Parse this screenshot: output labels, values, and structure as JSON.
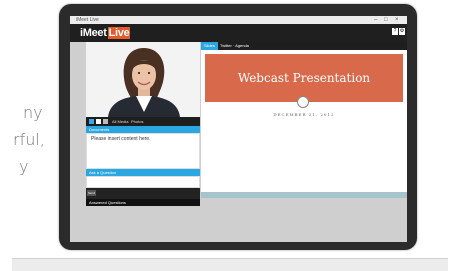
{
  "background_text": [
    "ny",
    "rful,",
    "y"
  ],
  "window": {
    "title": "iMeet Live",
    "controls": [
      "–",
      "□",
      "×"
    ]
  },
  "app": {
    "logo_prefix": "iMeet",
    "logo_suffix": "Live",
    "header_buttons": [
      "?",
      "⚙"
    ]
  },
  "video": {
    "toolbar_labels": [
      "All Media",
      "Photos"
    ]
  },
  "documents": {
    "header": "Documents",
    "content": "Please insert content here."
  },
  "questions": {
    "header": "Ask a Question",
    "send_label": "Send"
  },
  "answered": {
    "label": "Answered Questions"
  },
  "tabs": [
    {
      "label": "Slides",
      "active": true
    },
    {
      "label": "Twitter · Agenda",
      "active": false
    }
  ],
  "slide": {
    "title": "Webcast Presentation",
    "date": "DECEMBER 31, 2012"
  },
  "colors": {
    "accent": "#2aa7e0",
    "slide_band": "#d86a4b",
    "logo_live": "#e35a2b"
  }
}
